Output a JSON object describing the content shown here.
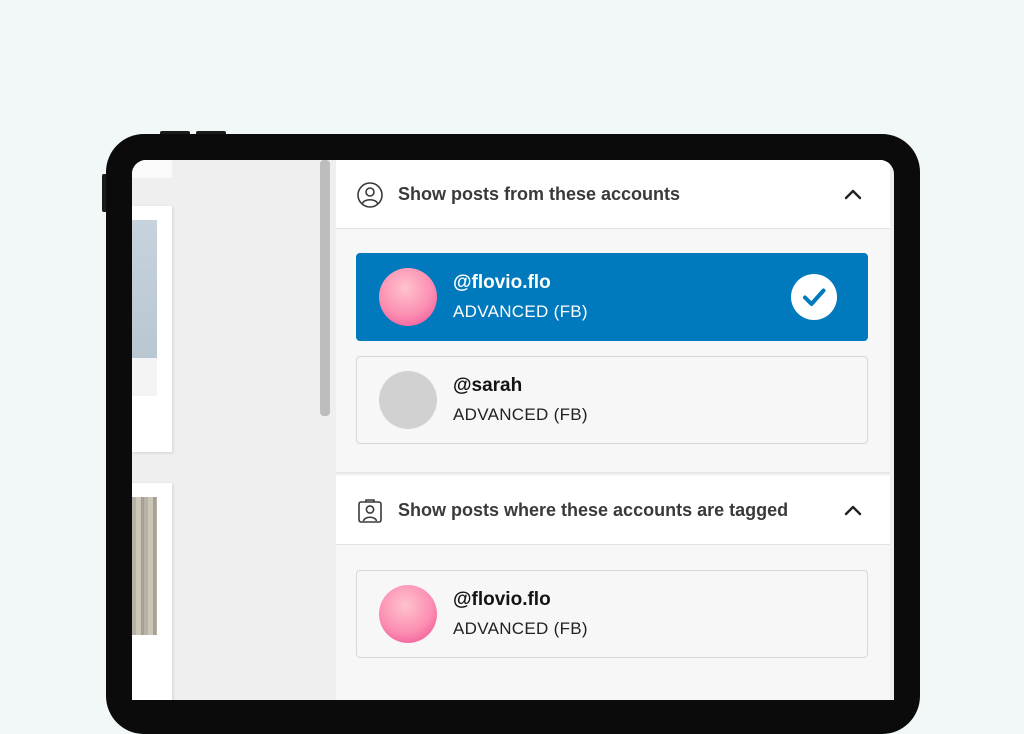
{
  "colors": {
    "background": "#f1f8f7",
    "selected_accent": "#0179bd",
    "avatar_pink": "#f7a2bd",
    "avatar_grey": "#d1d1d1"
  },
  "filters": {
    "posts_from": {
      "title": "Show posts from these accounts",
      "icon": "user-circle-icon",
      "toggle_icon": "chevron-up-icon",
      "expanded": true,
      "accounts": [
        {
          "handle": "@flovio.flo",
          "plan": "ADVANCED (FB)",
          "selected": true,
          "avatar": "pink-gradient"
        },
        {
          "handle": "@sarah",
          "plan": "ADVANCED (FB)",
          "selected": false,
          "avatar": "grey-placeholder"
        }
      ]
    },
    "posts_tagged": {
      "title": "Show posts where these accounts are tagged",
      "icon": "tagged-user-icon",
      "toggle_icon": "chevron-up-icon",
      "expanded": true,
      "accounts": [
        {
          "handle": "@flovio.flo",
          "plan": "ADVANCED (FB)",
          "selected": false,
          "avatar": "pink-gradient"
        }
      ]
    }
  }
}
